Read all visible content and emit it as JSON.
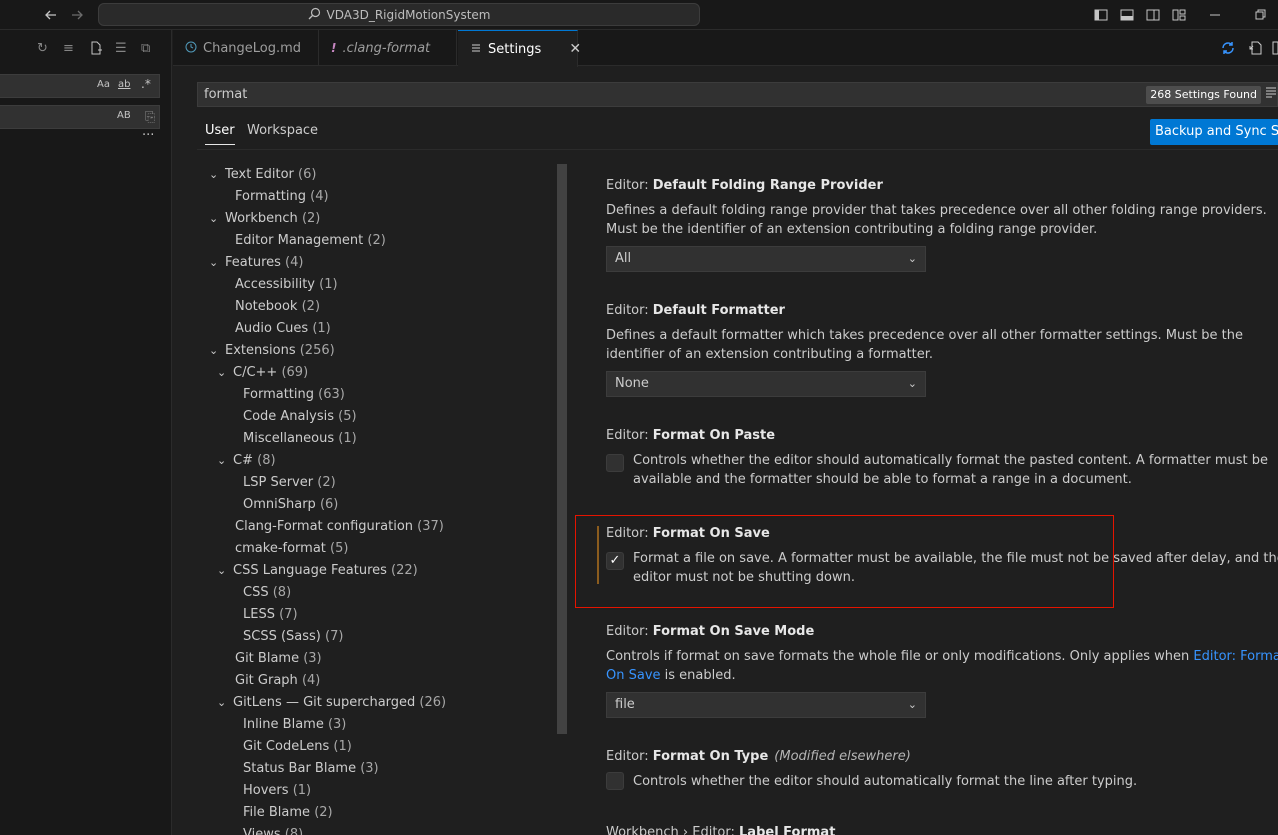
{
  "titlebar": {
    "title": "VDA3D_RigidMotionSystem",
    "icons": [
      "arrow-left-icon",
      "arrow-right-icon",
      "search-icon",
      "toggle-sidebar-icon",
      "toggle-panel-icon",
      "toggle-secondary-sidebar-icon",
      "customize-layout-icon",
      "minimize-icon",
      "restore-icon"
    ]
  },
  "sidebar": {
    "toolbar_icons": [
      "refresh-icon",
      "clear-results-icon",
      "new-search-editor-icon",
      "collapse-all-icon",
      "view-as-tree-icon"
    ],
    "search": {
      "value": "",
      "options": [
        "Aa",
        "ab",
        ".*"
      ]
    },
    "replace": {
      "value": "",
      "option": "AB"
    },
    "more": "···"
  },
  "tabs": [
    {
      "label": "ChangeLog.md",
      "icon": "info-icon",
      "active": false
    },
    {
      "label": ".clang-format",
      "icon": "exclamation-icon",
      "active": false
    },
    {
      "label": "Settings",
      "icon": "settings-lines-icon",
      "active": true,
      "close": "✕"
    }
  ],
  "settings": {
    "search_value": "format",
    "found_label": "268 Settings Found",
    "scope_tabs": [
      "User",
      "Workspace"
    ],
    "sync_button": "Backup and Sync Settings",
    "toc": [
      {
        "label": "Text Editor",
        "count": "(6)",
        "level": 0,
        "chev": true
      },
      {
        "label": "Formatting",
        "count": "(4)",
        "level": 1,
        "chev": false
      },
      {
        "label": "Workbench",
        "count": "(2)",
        "level": 0,
        "chev": true
      },
      {
        "label": "Editor Management",
        "count": "(2)",
        "level": 1,
        "chev": false
      },
      {
        "label": "Features",
        "count": "(4)",
        "level": 0,
        "chev": true
      },
      {
        "label": "Accessibility",
        "count": "(1)",
        "level": 1,
        "chev": false
      },
      {
        "label": "Notebook",
        "count": "(2)",
        "level": 1,
        "chev": false
      },
      {
        "label": "Audio Cues",
        "count": "(1)",
        "level": 1,
        "chev": false
      },
      {
        "label": "Extensions",
        "count": "(256)",
        "level": 0,
        "chev": true
      },
      {
        "label": "C/C++",
        "count": "(69)",
        "level": 1,
        "chev": true
      },
      {
        "label": "Formatting",
        "count": "(63)",
        "level": 2,
        "chev": false
      },
      {
        "label": "Code Analysis",
        "count": "(5)",
        "level": 2,
        "chev": false
      },
      {
        "label": "Miscellaneous",
        "count": "(1)",
        "level": 2,
        "chev": false
      },
      {
        "label": "C#",
        "count": "(8)",
        "level": 1,
        "chev": true
      },
      {
        "label": "LSP Server",
        "count": "(2)",
        "level": 2,
        "chev": false
      },
      {
        "label": "OmniSharp",
        "count": "(6)",
        "level": 2,
        "chev": false
      },
      {
        "label": "Clang-Format configuration",
        "count": "(37)",
        "level": 1,
        "chev": false
      },
      {
        "label": "cmake-format",
        "count": "(5)",
        "level": 1,
        "chev": false
      },
      {
        "label": "CSS Language Features",
        "count": "(22)",
        "level": 1,
        "chev": true
      },
      {
        "label": "CSS",
        "count": "(8)",
        "level": 2,
        "chev": false
      },
      {
        "label": "LESS",
        "count": "(7)",
        "level": 2,
        "chev": false
      },
      {
        "label": "SCSS (Sass)",
        "count": "(7)",
        "level": 2,
        "chev": false
      },
      {
        "label": "Git Blame",
        "count": "(3)",
        "level": 1,
        "chev": false
      },
      {
        "label": "Git Graph",
        "count": "(4)",
        "level": 1,
        "chev": false
      },
      {
        "label": "GitLens — Git supercharged",
        "count": "(26)",
        "level": 1,
        "chev": true
      },
      {
        "label": "Inline Blame",
        "count": "(3)",
        "level": 2,
        "chev": false
      },
      {
        "label": "Git CodeLens",
        "count": "(1)",
        "level": 2,
        "chev": false
      },
      {
        "label": "Status Bar Blame",
        "count": "(3)",
        "level": 2,
        "chev": false
      },
      {
        "label": "Hovers",
        "count": "(1)",
        "level": 2,
        "chev": false
      },
      {
        "label": "File Blame",
        "count": "(2)",
        "level": 2,
        "chev": false
      },
      {
        "label": "Views",
        "count": "(8)",
        "level": 2,
        "chev": false
      }
    ],
    "items": [
      {
        "category": "Editor: ",
        "name": "Default Folding Range Provider",
        "description": "Defines a default folding range provider that takes precedence over all other folding range providers. Must be the identifier of an extension contributing a folding range provider.",
        "control": "select",
        "value": "All"
      },
      {
        "category": "Editor: ",
        "name": "Default Formatter",
        "description": "Defines a default formatter which takes precedence over all other formatter settings. Must be the identifier of an extension contributing a formatter.",
        "control": "select",
        "value": "None"
      },
      {
        "category": "Editor: ",
        "name": "Format On Paste",
        "description": "Controls whether the editor should automatically format the pasted content. A formatter must be available and the formatter should be able to format a range in a document.",
        "control": "checkbox",
        "checked": false
      },
      {
        "category": "Editor: ",
        "name": "Format On Save",
        "description": "Format a file on save. A formatter must be available, the file must not be saved after delay, and the editor must not be shutting down.",
        "control": "checkbox",
        "checked": true,
        "modified": true
      },
      {
        "category": "Editor: ",
        "name": "Format On Save Mode",
        "description_before": "Controls if format on save formats the whole file or only modifications. Only applies when ",
        "description_link": "Editor: Format On Save",
        "description_after": " is enabled.",
        "control": "select",
        "value": "file"
      },
      {
        "category": "Editor: ",
        "name": "Format On Type",
        "note": "(Modified elsewhere)",
        "description": "Controls whether the editor should automatically format the line after typing.",
        "control": "checkbox",
        "checked": false
      },
      {
        "category": "Workbench › Editor: ",
        "name": "Label Format",
        "description": "",
        "control": "none"
      }
    ],
    "colors": {
      "accent": "#0078d4",
      "highlight": "#e51400",
      "link": "#3794ff"
    }
  }
}
